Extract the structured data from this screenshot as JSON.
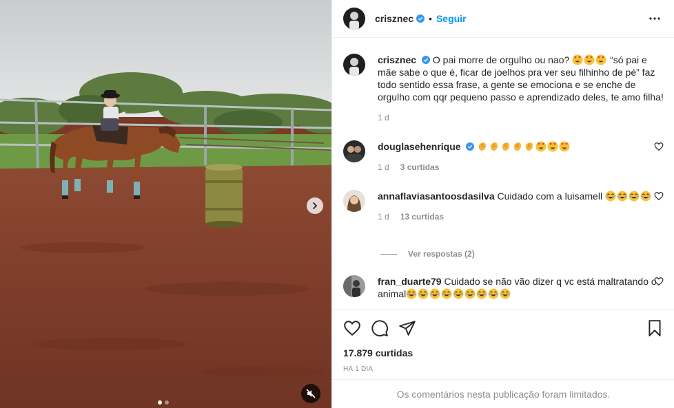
{
  "post": {
    "author": "crisznec",
    "follow_label": "Seguir",
    "separator": "•",
    "caption": {
      "user": "crisznec",
      "text_before_emoji": "O pai morre de orgulho ou nao?",
      "text_after_emoji": "“só pai e mãe sabe o que é, ficar de joelhos pra ver seu filhinho de pé” faz todo sentido essa frase, a gente se emociona e se enche de orgulho com qqr pequeno passo e aprendizado deles, te amo filha!",
      "age": "1 d"
    },
    "comments": [
      {
        "user": "douglasehenrique",
        "verified": true,
        "text": "",
        "age": "1 d",
        "likes": "3 curtidas"
      },
      {
        "user": "annaflaviasantoosdasilva",
        "verified": false,
        "text": "Cuidado com a luisamell",
        "age": "1 d",
        "likes": "13 curtidas"
      },
      {
        "user": "fran_duarte79",
        "verified": false,
        "text": "Cuidado se não vão dizer q vc está maltratando o animal"
      }
    ],
    "view_replies": "Ver respostas (2)",
    "likes_count": "17.879 curtidas",
    "posted": "HÁ 1 DIA",
    "limited_notice": "Os comentários nesta publicação foram limitados."
  },
  "media": {
    "carousel_dots": 2,
    "active_dot": 0
  },
  "icons": {
    "verified": "verified-badge-icon",
    "more": "more-options-icon",
    "like": "heart-icon",
    "comment": "comment-icon",
    "share": "share-icon",
    "save": "bookmark-icon",
    "next": "chevron-right-icon",
    "mute": "muted-speaker-icon"
  },
  "colors": {
    "accent": "#0095f6",
    "muted_text": "#8e8e8e",
    "border": "#efefef"
  }
}
